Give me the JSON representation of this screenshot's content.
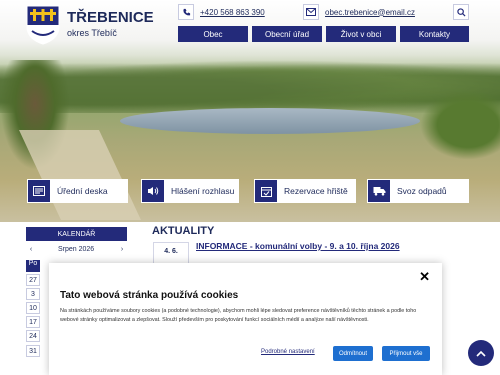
{
  "header": {
    "title": "TŘEBENICE",
    "subtitle": "okres Třebíč",
    "logo_icon": "coat-of-arms-icon",
    "phone": "+420 568 863 390",
    "email": "obec.trebenice@email.cz"
  },
  "nav": [
    "Obec",
    "Obecní úřad",
    "Život v obci",
    "Kontakty"
  ],
  "quick_links": [
    {
      "label": "Úřední deska",
      "icon": "noticeboard-icon"
    },
    {
      "label": "Hlášení rozhlasu",
      "icon": "speaker-icon"
    },
    {
      "label": "Rezervace hřiště",
      "icon": "calendar-check-icon"
    },
    {
      "label": "Svoz odpadů",
      "icon": "truck-icon"
    }
  ],
  "calendar": {
    "title": "KALENDÁŘ",
    "month": "Srpen 2026",
    "dow": "Po",
    "days": [
      "27",
      "3",
      "10",
      "17",
      "24",
      "31"
    ]
  },
  "news": {
    "section_title": "AKTUALITY",
    "items": [
      {
        "date": "4. 6.",
        "title": "INFORMACE - komunální volby - 9. a 10. října 2026"
      }
    ]
  },
  "cookie": {
    "title": "Tato webová stránka používá cookies",
    "text": "Na stránkách používáme soubory cookies (a podobné technologie), abychom mohli lépe sledovat preference návštěvníků těchto stránek a podle toho webové stránky optimalizovat a zlepšovat. Slouží především pro poskytování funkcí sociálních médií a analýze naší návštěvnosti.",
    "settings_label": "Podrobné nastavení",
    "reject_label": "Odmítnout",
    "accept_label": "Přijmout vše",
    "close": "✕"
  },
  "colors": {
    "brand": "#232a7a",
    "accent": "#1e6fd0"
  }
}
